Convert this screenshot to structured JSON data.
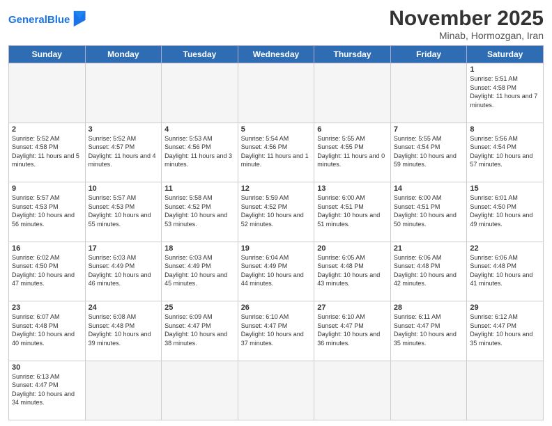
{
  "header": {
    "logo_general": "General",
    "logo_blue": "Blue",
    "month_title": "November 2025",
    "location": "Minab, Hormozgan, Iran"
  },
  "weekdays": [
    "Sunday",
    "Monday",
    "Tuesday",
    "Wednesday",
    "Thursday",
    "Friday",
    "Saturday"
  ],
  "weeks": [
    [
      {
        "day": "",
        "info": ""
      },
      {
        "day": "",
        "info": ""
      },
      {
        "day": "",
        "info": ""
      },
      {
        "day": "",
        "info": ""
      },
      {
        "day": "",
        "info": ""
      },
      {
        "day": "",
        "info": ""
      },
      {
        "day": "1",
        "info": "Sunrise: 5:51 AM\nSunset: 4:58 PM\nDaylight: 11 hours and 7 minutes."
      }
    ],
    [
      {
        "day": "2",
        "info": "Sunrise: 5:52 AM\nSunset: 4:58 PM\nDaylight: 11 hours and 5 minutes."
      },
      {
        "day": "3",
        "info": "Sunrise: 5:52 AM\nSunset: 4:57 PM\nDaylight: 11 hours and 4 minutes."
      },
      {
        "day": "4",
        "info": "Sunrise: 5:53 AM\nSunset: 4:56 PM\nDaylight: 11 hours and 3 minutes."
      },
      {
        "day": "5",
        "info": "Sunrise: 5:54 AM\nSunset: 4:56 PM\nDaylight: 11 hours and 1 minute."
      },
      {
        "day": "6",
        "info": "Sunrise: 5:55 AM\nSunset: 4:55 PM\nDaylight: 11 hours and 0 minutes."
      },
      {
        "day": "7",
        "info": "Sunrise: 5:55 AM\nSunset: 4:54 PM\nDaylight: 10 hours and 59 minutes."
      },
      {
        "day": "8",
        "info": "Sunrise: 5:56 AM\nSunset: 4:54 PM\nDaylight: 10 hours and 57 minutes."
      }
    ],
    [
      {
        "day": "9",
        "info": "Sunrise: 5:57 AM\nSunset: 4:53 PM\nDaylight: 10 hours and 56 minutes."
      },
      {
        "day": "10",
        "info": "Sunrise: 5:57 AM\nSunset: 4:53 PM\nDaylight: 10 hours and 55 minutes."
      },
      {
        "day": "11",
        "info": "Sunrise: 5:58 AM\nSunset: 4:52 PM\nDaylight: 10 hours and 53 minutes."
      },
      {
        "day": "12",
        "info": "Sunrise: 5:59 AM\nSunset: 4:52 PM\nDaylight: 10 hours and 52 minutes."
      },
      {
        "day": "13",
        "info": "Sunrise: 6:00 AM\nSunset: 4:51 PM\nDaylight: 10 hours and 51 minutes."
      },
      {
        "day": "14",
        "info": "Sunrise: 6:00 AM\nSunset: 4:51 PM\nDaylight: 10 hours and 50 minutes."
      },
      {
        "day": "15",
        "info": "Sunrise: 6:01 AM\nSunset: 4:50 PM\nDaylight: 10 hours and 49 minutes."
      }
    ],
    [
      {
        "day": "16",
        "info": "Sunrise: 6:02 AM\nSunset: 4:50 PM\nDaylight: 10 hours and 47 minutes."
      },
      {
        "day": "17",
        "info": "Sunrise: 6:03 AM\nSunset: 4:49 PM\nDaylight: 10 hours and 46 minutes."
      },
      {
        "day": "18",
        "info": "Sunrise: 6:03 AM\nSunset: 4:49 PM\nDaylight: 10 hours and 45 minutes."
      },
      {
        "day": "19",
        "info": "Sunrise: 6:04 AM\nSunset: 4:49 PM\nDaylight: 10 hours and 44 minutes."
      },
      {
        "day": "20",
        "info": "Sunrise: 6:05 AM\nSunset: 4:48 PM\nDaylight: 10 hours and 43 minutes."
      },
      {
        "day": "21",
        "info": "Sunrise: 6:06 AM\nSunset: 4:48 PM\nDaylight: 10 hours and 42 minutes."
      },
      {
        "day": "22",
        "info": "Sunrise: 6:06 AM\nSunset: 4:48 PM\nDaylight: 10 hours and 41 minutes."
      }
    ],
    [
      {
        "day": "23",
        "info": "Sunrise: 6:07 AM\nSunset: 4:48 PM\nDaylight: 10 hours and 40 minutes."
      },
      {
        "day": "24",
        "info": "Sunrise: 6:08 AM\nSunset: 4:48 PM\nDaylight: 10 hours and 39 minutes."
      },
      {
        "day": "25",
        "info": "Sunrise: 6:09 AM\nSunset: 4:47 PM\nDaylight: 10 hours and 38 minutes."
      },
      {
        "day": "26",
        "info": "Sunrise: 6:10 AM\nSunset: 4:47 PM\nDaylight: 10 hours and 37 minutes."
      },
      {
        "day": "27",
        "info": "Sunrise: 6:10 AM\nSunset: 4:47 PM\nDaylight: 10 hours and 36 minutes."
      },
      {
        "day": "28",
        "info": "Sunrise: 6:11 AM\nSunset: 4:47 PM\nDaylight: 10 hours and 35 minutes."
      },
      {
        "day": "29",
        "info": "Sunrise: 6:12 AM\nSunset: 4:47 PM\nDaylight: 10 hours and 35 minutes."
      }
    ],
    [
      {
        "day": "30",
        "info": "Sunrise: 6:13 AM\nSunset: 4:47 PM\nDaylight: 10 hours and 34 minutes."
      },
      {
        "day": "",
        "info": ""
      },
      {
        "day": "",
        "info": ""
      },
      {
        "day": "",
        "info": ""
      },
      {
        "day": "",
        "info": ""
      },
      {
        "day": "",
        "info": ""
      },
      {
        "day": "",
        "info": ""
      }
    ]
  ]
}
